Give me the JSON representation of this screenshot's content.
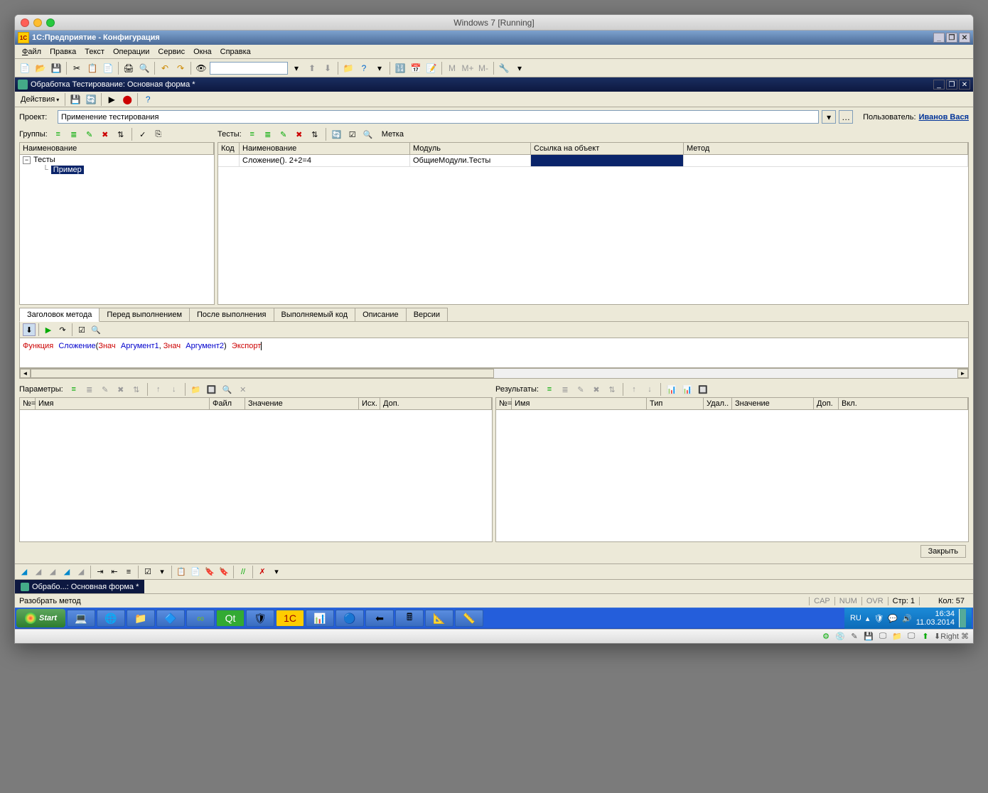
{
  "mac_title": "Windows 7 [Running]",
  "app_title": "1C:Предприятие - Конфигурация",
  "menu": {
    "file": "Файл",
    "edit": "Правка",
    "text": "Текст",
    "operations": "Операции",
    "service": "Сервис",
    "windows": "Окна",
    "help": "Справка"
  },
  "doc_title": "Обработка Тестирование: Основная форма *",
  "doc_actions": "Действия",
  "project_label": "Проект:",
  "project_value": "Применение тестирования",
  "user_label": "Пользователь:",
  "user_value": "Иванов Вася",
  "groups_label": "Группы:",
  "tests_label": "Тесты:",
  "metka_label": "Метка",
  "tree": {
    "name_header": "Наименование",
    "root": "Тесты",
    "child": "Пример"
  },
  "tests_grid": {
    "headers": {
      "code": "Код",
      "name": "Наименование",
      "module": "Модуль",
      "link": "Ссылка на объект",
      "method": "Метод"
    },
    "row": {
      "code": "",
      "name": "Сложение(). 2+2=4",
      "module": "ОбщиеМодули.Тесты",
      "link": "",
      "method": ""
    }
  },
  "tabs": {
    "header": "Заголовок метода",
    "before": "Перед выполнением",
    "after": "После выполнения",
    "code": "Выполняемый код",
    "desc": "Описание",
    "versions": "Версии"
  },
  "code": {
    "kw_func": "Функция",
    "id_name": "Сложение",
    "paren_open": "(",
    "kw_val1": "Знач",
    "id_arg1": "Аргумент1",
    "comma": ", ",
    "kw_val2": "Знач",
    "id_arg2": "Аргумент2",
    "paren_close": ")",
    "kw_export": "Экспорт"
  },
  "params_label": "Параметры:",
  "results_label": "Результаты:",
  "params_headers": {
    "num": "№=",
    "name": "Имя",
    "file": "Файл",
    "value": "Значение",
    "src": "Исх.",
    "extra": "Доп."
  },
  "results_headers": {
    "num": "№=",
    "name": "Имя",
    "type": "Тип",
    "del": "Удал..",
    "value": "Значение",
    "extra": "Доп.",
    "incl": "Вкл."
  },
  "close_btn": "Закрыть",
  "doc_tab": "Обрабо...: Основная форма *",
  "status_msg": "Разобрать метод",
  "status": {
    "cap": "CAP",
    "num": "NUM",
    "ovr": "OVR",
    "row": "Стр: 1",
    "col": "Кол: 57"
  },
  "start": "Start",
  "lang": "RU",
  "clock": {
    "time": "16:34",
    "date": "11.03.2014"
  },
  "vm_right": "Right ⌘",
  "m_labels": {
    "m": "M",
    "mplus": "M+",
    "mminus": "M-"
  }
}
